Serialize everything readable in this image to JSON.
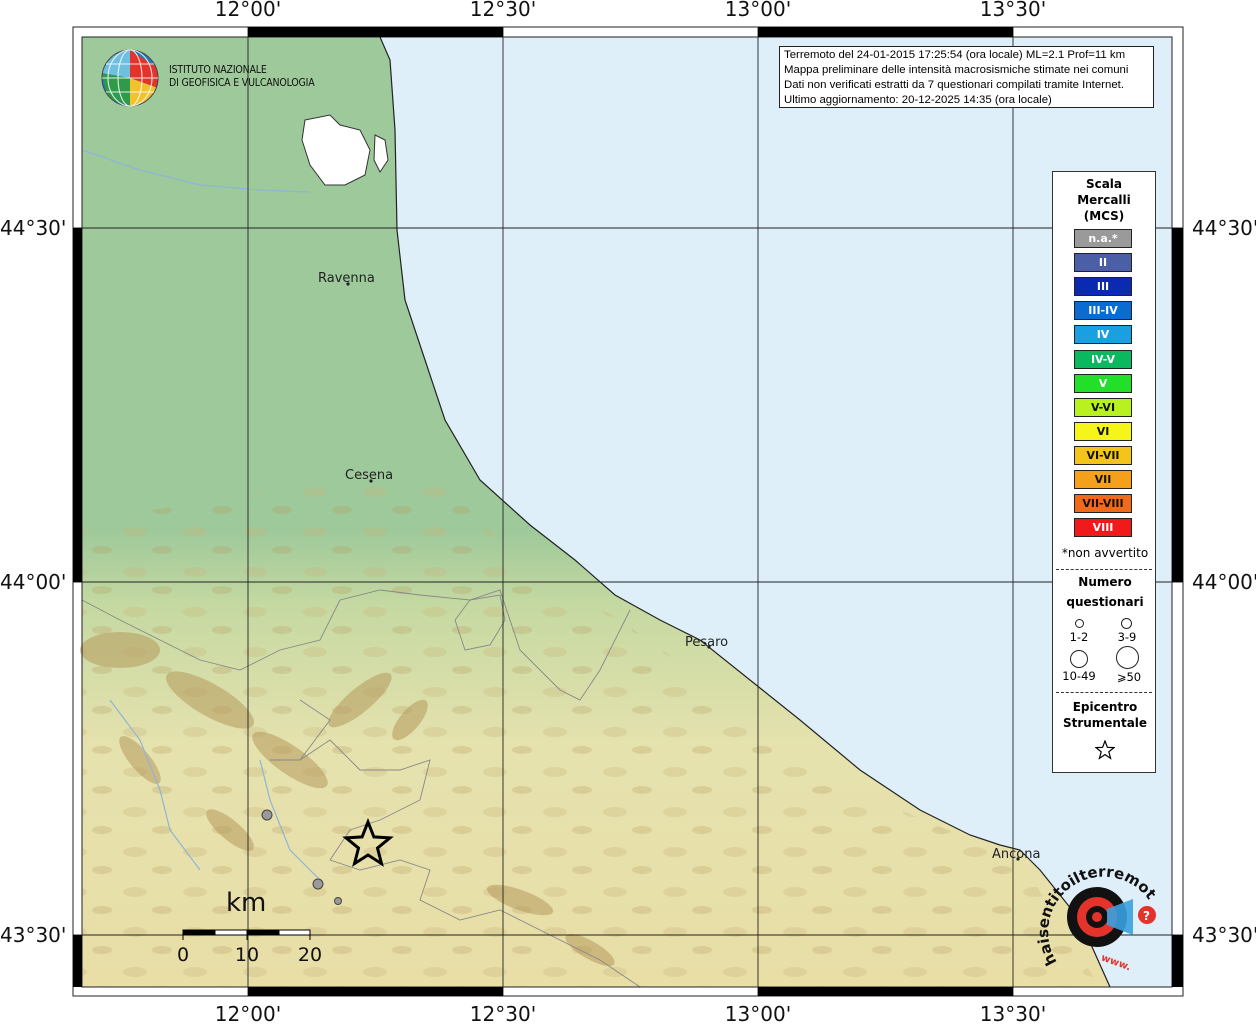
{
  "map": {
    "longitude_labels": [
      "12°00'",
      "12°30'",
      "13°00'",
      "13°30'"
    ],
    "latitude_labels": [
      "44°30'",
      "44°00'",
      "43°30'"
    ],
    "colors": {
      "sea": "#dfeffa",
      "lowland": "#9ec99a",
      "hills": "#e8e2ad",
      "mountains": "#b49a5e"
    }
  },
  "header": {
    "line1": "Terremoto del 24-01-2015 17:25:54 (ora locale) ML=2.1 Prof=11 km",
    "line2": "Mappa preliminare delle intensità macrosismiche stimate nei comuni",
    "line3": "Dati non verificati estratti da 7 questionari compilati tramite Internet.",
    "line4": "Ultimo aggiornamento: 20-12-2025 14:35 (ora locale)"
  },
  "institute": {
    "line1": "ISTITUTO NAZIONALE",
    "line2": "DI GEOFISICA E VULCANOLOGIA"
  },
  "legend": {
    "title_line1": "Scala",
    "title_line2": "Mercalli",
    "title_line3": "(MCS)",
    "scale": [
      {
        "label": "n.a.*",
        "color": "#9a9a9a"
      },
      {
        "label": "II",
        "color": "#4a5fa6"
      },
      {
        "label": "III",
        "color": "#0a2bb0"
      },
      {
        "label": "III-IV",
        "color": "#0a6bd0"
      },
      {
        "label": "IV",
        "color": "#1a9fe0"
      },
      {
        "label": "IV-V",
        "color": "#0ab860"
      },
      {
        "label": "V",
        "color": "#22e02a"
      },
      {
        "label": "V-VI",
        "color": "#b8f020"
      },
      {
        "label": "VI",
        "color": "#f5f51a"
      },
      {
        "label": "VI-VII",
        "color": "#f5c41a"
      },
      {
        "label": "VII",
        "color": "#f5a01a"
      },
      {
        "label": "VII-VIII",
        "color": "#f06a1a"
      },
      {
        "label": "VIII",
        "color": "#f01a1a"
      }
    ],
    "note": "*non avvertito",
    "questionnaires_title_line1": "Numero",
    "questionnaires_title_line2": "questionari",
    "questionnaire_sizes": [
      "1-2",
      "3-9",
      "10-49",
      "⩾50"
    ],
    "epicenter_title_line1": "Epicentro",
    "epicenter_title_line2": "Strumentale"
  },
  "cities": [
    "Ravenna",
    "Cesena",
    "Pesaro",
    "Ancona"
  ],
  "scalebar": {
    "unit": "km",
    "ticks": [
      "0",
      "10",
      "20"
    ]
  },
  "sentito_logo": {
    "text": "haisentitoilterremoto.it",
    "url_text": "www."
  }
}
